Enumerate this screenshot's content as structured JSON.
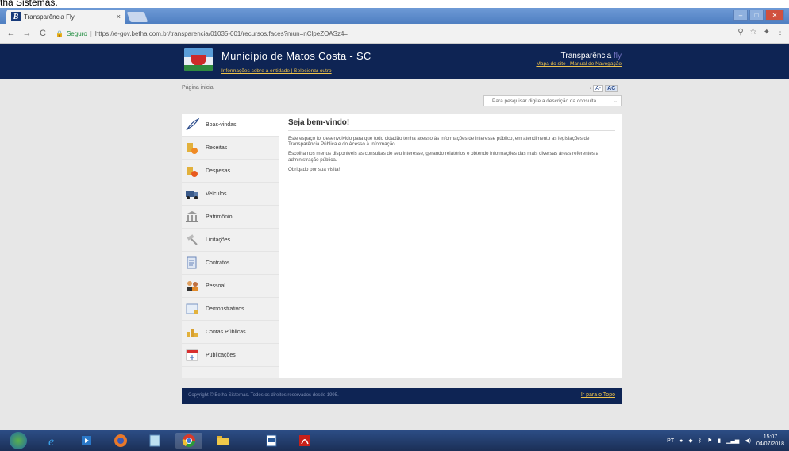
{
  "caption": "tha Sistemas.",
  "browser": {
    "tab_title": "Transparência Fly",
    "tab_logo": "B",
    "tab_close": "×",
    "secure_label": "Seguro",
    "url": "https://e-gov.betha.com.br/transparencia/01035-001/recursos.faces?mun=nClpeZOASz4=",
    "nav_back": "←",
    "nav_forward": "→",
    "nav_reload": "C"
  },
  "header": {
    "municipality": "Município de Matos Costa - SC",
    "municipality_links": "Informações sobre a entidade | Selecionar outro",
    "brand_name": "Transparência",
    "brand_suffix": "fly",
    "brand_links": "Mapa do site | Manual de Navegação"
  },
  "breadcrumb": "Página inicial",
  "font_controls": {
    "decrease": "A-",
    "normal": "AC"
  },
  "search": {
    "placeholder": "Para pesquisar digite a descrição da consulta"
  },
  "sidebar": {
    "items": [
      {
        "label": "Boas-vindas",
        "icon": "quill-icon"
      },
      {
        "label": "Receitas",
        "icon": "coins-icon"
      },
      {
        "label": "Despesas",
        "icon": "coins-out-icon"
      },
      {
        "label": "Veículos",
        "icon": "truck-icon"
      },
      {
        "label": "Patrimônio",
        "icon": "building-icon"
      },
      {
        "label": "Licitações",
        "icon": "gavel-icon"
      },
      {
        "label": "Contratos",
        "icon": "contract-icon"
      },
      {
        "label": "Pessoal",
        "icon": "people-icon"
      },
      {
        "label": "Demonstrativos",
        "icon": "report-icon"
      },
      {
        "label": "Contas Públicas",
        "icon": "chart-icon"
      },
      {
        "label": "Publicações",
        "icon": "calendar-icon"
      }
    ]
  },
  "content": {
    "title": "Seja bem-vindo!",
    "paragraphs": [
      "Este espaço foi desenvolvido para que todo cidadão tenha acesso às informações de interesse público, em atendimento as legislações de Transparência Pública e do Acesso à Informação.",
      "Escolha nos menus disponíveis as consultas de seu interesse, gerando relatórios e obtendo informações das mais diversas áreas referentes a administração pública.",
      "Obrigado por sua visita!"
    ]
  },
  "footer": {
    "copyright": "Copyright © Betha Sistemas. Todos os direitos reservados desde 1995.",
    "to_top": "Ir para o Topo"
  },
  "taskbar": {
    "lang": "PT",
    "time": "15:07",
    "date": "04/07/2018"
  },
  "colors": {
    "banner": "#0e2454",
    "link_gold": "#f0c34a",
    "taskbar": "#1b2f56"
  }
}
